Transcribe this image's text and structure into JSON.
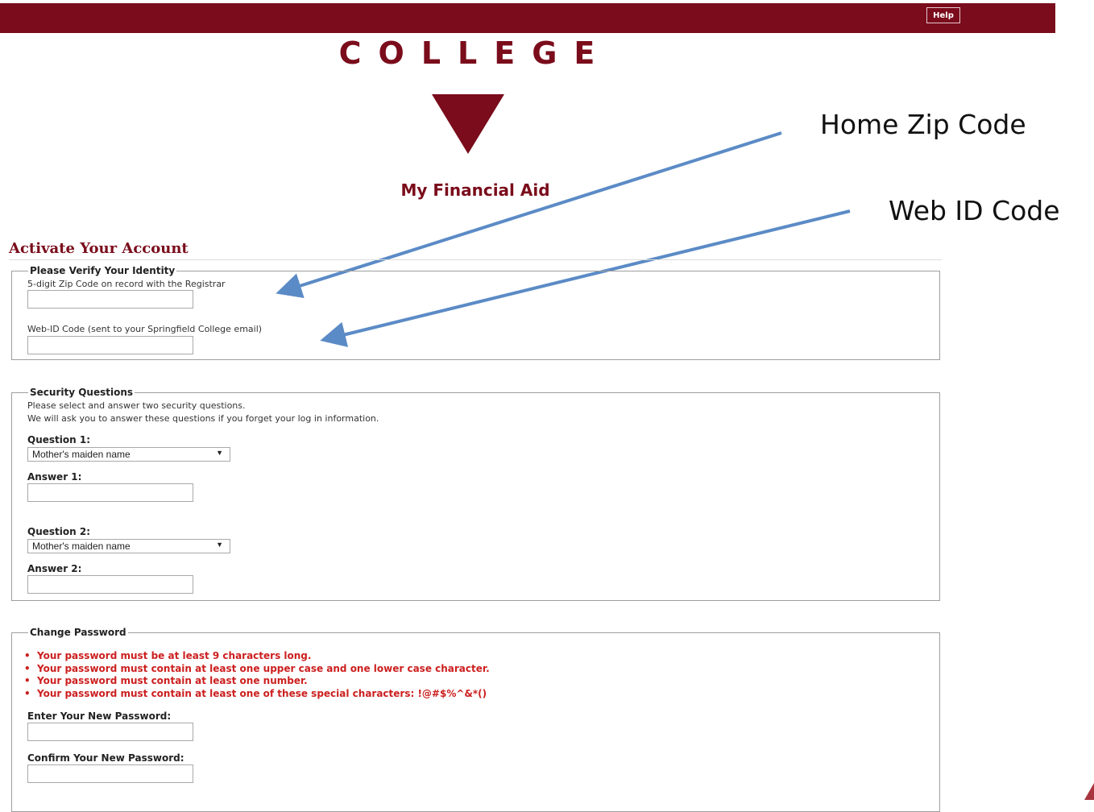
{
  "header": {
    "help_label": "Help"
  },
  "branding": {
    "college_wordmark": "COLLEGE",
    "logo": "inverted-triangle-logo",
    "brand_color": "#7a0c1b"
  },
  "page": {
    "heading": "My Financial Aid",
    "section_title": "Activate Your Account"
  },
  "annotations": {
    "zip_note": "Home Zip Code",
    "webid_note": "Web ID Code",
    "arrow_color": "#5b8bc6"
  },
  "identity": {
    "legend": "Please Verify Your Identity",
    "zip_label": "5-digit Zip Code on record with the Registrar",
    "zip_value": "",
    "webid_label": "Web-ID Code (sent to your Springfield College email)",
    "webid_value": ""
  },
  "security": {
    "legend": "Security Questions",
    "intro_line1": "Please select and answer two security questions.",
    "intro_line2": "We will ask you to answer these questions if you forget your log in information.",
    "q1_label": "Question 1:",
    "q1_selected": "Mother's maiden name",
    "a1_label": "Answer 1:",
    "a1_value": "",
    "q2_label": "Question 2:",
    "q2_selected": "Mother's maiden name",
    "a2_label": "Answer 2:",
    "a2_value": ""
  },
  "password": {
    "legend": "Change Password",
    "rules": [
      "Your password must be at least 9 characters long.",
      "Your password must contain at least one upper case and one lower case character.",
      "Your password must contain at least one number.",
      "Your password must contain at least one of these special characters: !@#$%^&*()"
    ],
    "rule_color": "#cc1f1f",
    "new_label": "Enter Your New Password:",
    "new_value": "",
    "confirm_label": "Confirm Your New Password:",
    "confirm_value": ""
  }
}
